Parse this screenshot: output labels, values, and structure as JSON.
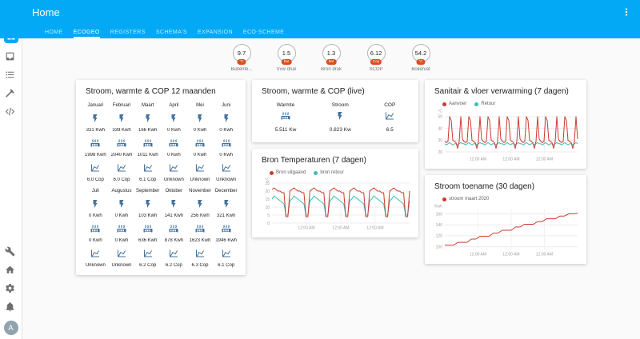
{
  "colors": {
    "primary": "#03a9f4",
    "icon_blue": "#44739e",
    "badge_unit_bg": "#df4c1e",
    "chart_red": "#cb3a2f",
    "chart_teal": "#3fbdb4"
  },
  "header": {
    "title": "Home"
  },
  "tabs": [
    {
      "label": "HOME",
      "active": false
    },
    {
      "label": "ECOGEO",
      "active": true
    },
    {
      "label": "REGISTERS",
      "active": false
    },
    {
      "label": "SCHEMA'S",
      "active": false
    },
    {
      "label": "EXPANSION",
      "active": false
    },
    {
      "label": "ECO-SCHEME",
      "active": false
    }
  ],
  "sidebar": {
    "avatar": "A",
    "items": [
      {
        "name": "overview",
        "icon": "view-dashboard",
        "active": true
      },
      {
        "name": "inbox",
        "icon": "inbox",
        "active": false
      },
      {
        "name": "logbook",
        "icon": "format-list-bulleted",
        "active": false
      },
      {
        "name": "tools",
        "icon": "hammer",
        "active": false
      },
      {
        "name": "developer-tools",
        "icon": "xml",
        "active": false
      }
    ],
    "bottom": [
      {
        "name": "supervisor",
        "icon": "wrench"
      },
      {
        "name": "home",
        "icon": "home"
      },
      {
        "name": "configuration",
        "icon": "cog"
      },
      {
        "name": "notifications",
        "icon": "bell"
      }
    ]
  },
  "badges": [
    {
      "value": "9.7",
      "unit": "°C",
      "label": "Buitente..."
    },
    {
      "value": "1.5",
      "unit": "bar",
      "label": "Vvw druk"
    },
    {
      "value": "1.3",
      "unit": "bar",
      "label": "Bron druk"
    },
    {
      "value": "6.12",
      "unit": "Cop",
      "label": "SCOP"
    },
    {
      "value": "54.2",
      "unit": "°C",
      "label": "Boilervat"
    }
  ],
  "card_12maanden": {
    "title": "Stroom, warmte & COP 12 maanden",
    "rows": [
      {
        "type": "labels",
        "items": [
          "Januari",
          "Februari",
          "Maart",
          "April",
          "Mei",
          "Juni"
        ]
      },
      {
        "type": "icons",
        "icon": "flash"
      },
      {
        "type": "values",
        "items": [
          "331 Kwh",
          "339 Kwh",
          "166 Kwh",
          "0 Kwh",
          "0 Kwh",
          "0 Kwh"
        ]
      },
      {
        "type": "icons",
        "icon": "radiator"
      },
      {
        "type": "values",
        "items": [
          "1998 Kwh",
          "2040 Kwh",
          "1011 Kwh",
          "0 Kwh",
          "0 Kwh",
          "0 Kwh"
        ]
      },
      {
        "type": "icons",
        "icon": "chart-line"
      },
      {
        "type": "values",
        "items": [
          "6.0 Cop",
          "6.0 Cop",
          "6.1 Cop",
          "Unknown",
          "Unknown",
          "Unknown"
        ]
      },
      {
        "type": "labels",
        "items": [
          "Juli",
          "Augustus",
          "September",
          "Oktober",
          "November",
          "December"
        ]
      },
      {
        "type": "icons",
        "icon": "flash"
      },
      {
        "type": "values",
        "items": [
          "0 Kwh",
          "0 Kwh",
          "103 Kwh",
          "141 Kwh",
          "256 Kwh",
          "321 Kwh"
        ]
      },
      {
        "type": "icons",
        "icon": "radiator"
      },
      {
        "type": "values",
        "items": [
          "0 Kwh",
          "0 Kwh",
          "636 Kwh",
          "878 Kwh",
          "1623 Kwh",
          "1946 Kwh"
        ]
      },
      {
        "type": "icons",
        "icon": "chart-line"
      },
      {
        "type": "values",
        "items": [
          "Unknown",
          "Unknown",
          "6.2 Cop",
          "6.2 Cop",
          "6.3 Cop",
          "6.1 Cop"
        ]
      }
    ]
  },
  "card_live": {
    "title": "Stroom, warmte & COP (live)",
    "columns": [
      {
        "label": "Warmte",
        "icon": "radiator",
        "value": "5.511 Kw"
      },
      {
        "label": "Stroom",
        "icon": "flash",
        "value": "0.823 Kw"
      },
      {
        "label": "COP",
        "icon": "chart-line",
        "value": "6.5"
      }
    ]
  },
  "charts": {
    "bron": {
      "type": "line",
      "title": "Bron Temperaturen (7 dagen)",
      "ylabel": "°C",
      "ylim": [
        0,
        25
      ],
      "yticks": [
        0,
        5,
        10,
        15,
        20,
        25
      ],
      "xticks": [
        "12:00 AM",
        "12:00 AM",
        "12:00 AM"
      ],
      "series": [
        {
          "name": "Bron uitgaand",
          "color": "#cb3a2f",
          "values": [
            21,
            22,
            21,
            20,
            20,
            19,
            19,
            4,
            4,
            20,
            21,
            22,
            21,
            20,
            20,
            19,
            19,
            4,
            4,
            20,
            21,
            22,
            21,
            20,
            20,
            19,
            19,
            4,
            4,
            20,
            21,
            22,
            21,
            20,
            20,
            19,
            19,
            4,
            4,
            20,
            21,
            22,
            21,
            20,
            20,
            19,
            19,
            4,
            4,
            20,
            21,
            22,
            21,
            20,
            20,
            19,
            19,
            4,
            4,
            20,
            21,
            22,
            21,
            20,
            20,
            19,
            19,
            4,
            4,
            20
          ]
        },
        {
          "name": "bron retour",
          "color": "#3fbdb4",
          "values": [
            15,
            17,
            16,
            15,
            14,
            13,
            12,
            5,
            5,
            14,
            15,
            17,
            16,
            15,
            14,
            13,
            12,
            5,
            5,
            14,
            15,
            17,
            16,
            15,
            14,
            13,
            12,
            5,
            5,
            14,
            15,
            17,
            16,
            15,
            14,
            13,
            12,
            5,
            5,
            14,
            15,
            17,
            16,
            15,
            14,
            13,
            12,
            5,
            5,
            14,
            15,
            17,
            16,
            15,
            14,
            13,
            12,
            5,
            5,
            14,
            15,
            17,
            16,
            15,
            14,
            13,
            12,
            5,
            5,
            14
          ]
        }
      ]
    },
    "sanitair": {
      "type": "line",
      "title": "Sanitair & vloer verwarming (7 dagen)",
      "ylabel": "°C",
      "ylim": [
        18,
        52
      ],
      "yticks": [
        20,
        30,
        40,
        50
      ],
      "xticks": [
        "12:00 AM",
        "12:00 AM",
        "12:00 AM"
      ],
      "series": [
        {
          "name": "Aanvoer",
          "color": "#cb3a2f",
          "values": [
            29,
            28,
            29,
            50,
            47,
            30,
            29,
            28,
            23,
            29,
            50,
            31,
            29,
            28,
            29,
            50,
            47,
            30,
            29,
            28,
            23,
            29,
            50,
            31,
            29,
            28,
            29,
            50,
            47,
            30,
            29,
            28,
            23,
            29,
            50,
            31,
            29,
            28,
            29,
            50,
            47,
            30,
            29,
            28,
            23,
            29,
            50,
            31,
            29,
            28,
            29,
            50,
            47,
            30,
            29,
            28,
            23,
            29,
            50,
            31,
            29,
            28,
            29,
            50,
            47,
            30,
            29,
            28,
            23,
            29,
            50,
            31,
            29,
            28,
            29,
            50,
            47,
            30,
            29,
            28,
            23,
            29,
            50,
            31
          ]
        },
        {
          "name": "Retour",
          "color": "#3fbdb4",
          "values": [
            27,
            26,
            27,
            28,
            27,
            26,
            27,
            27,
            26,
            27,
            28,
            27,
            27,
            26,
            27,
            28,
            27,
            26,
            27,
            27,
            26,
            27,
            28,
            27,
            27,
            26,
            27,
            28,
            27,
            26,
            27,
            27,
            26,
            27,
            28,
            27,
            27,
            26,
            27,
            28,
            27,
            26,
            27,
            27,
            26,
            27,
            28,
            27,
            27,
            26,
            27,
            28,
            27,
            26,
            27,
            27,
            26,
            27,
            28,
            27,
            27,
            26,
            27,
            28,
            27,
            26,
            27,
            27,
            26,
            27,
            28,
            27,
            27,
            26,
            27,
            28,
            27,
            26,
            27,
            27,
            26,
            27,
            28,
            27
          ]
        }
      ]
    },
    "stroom": {
      "type": "line",
      "title": "Stroom toename (30 dagen)",
      "ylabel": "Kwh",
      "ylim": [
        95,
        168
      ],
      "yticks": [
        100,
        120,
        140,
        160
      ],
      "xticks": [
        "12:00 AM",
        "12:00 AM",
        "12:00 AM"
      ],
      "series": [
        {
          "name": "stroom maart 2020",
          "color": "#cb3a2f",
          "values": [
            103,
            103,
            103,
            108,
            108,
            108,
            114,
            114,
            119,
            119,
            119,
            125,
            125,
            130,
            130,
            130,
            136,
            136,
            141,
            141,
            141,
            146,
            146,
            151,
            151,
            151,
            156,
            156,
            160,
            160,
            161
          ]
        }
      ]
    }
  }
}
